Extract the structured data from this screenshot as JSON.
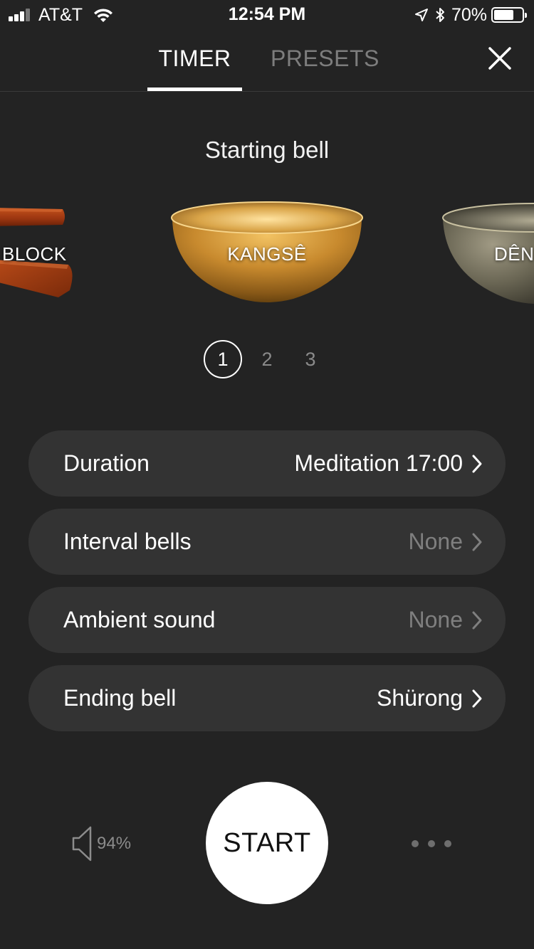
{
  "status_bar": {
    "carrier": "AT&T",
    "time": "12:54 PM",
    "battery_percent": "70%",
    "battery_level": 0.7
  },
  "header": {
    "tabs": [
      {
        "label": "TIMER",
        "active": true
      },
      {
        "label": "PRESETS",
        "active": false
      }
    ],
    "close_icon": "close-icon"
  },
  "starting_bell": {
    "title": "Starting bell",
    "bells": [
      {
        "label": "BLOCK"
      },
      {
        "label": "KANGSÊ",
        "selected": true
      },
      {
        "label": "DÊN"
      }
    ],
    "pages": [
      "1",
      "2",
      "3"
    ],
    "active_page": "1"
  },
  "settings": [
    {
      "label": "Duration",
      "value": "Meditation 17:00",
      "muted": false
    },
    {
      "label": "Interval bells",
      "value": "None",
      "muted": true
    },
    {
      "label": "Ambient sound",
      "value": "None",
      "muted": true
    },
    {
      "label": "Ending bell",
      "value": "Shürong",
      "muted": false
    }
  ],
  "controls": {
    "volume": "94%",
    "start_label": "START",
    "more_icon": "more-dots-icon"
  },
  "colors": {
    "background": "#232323",
    "row_background": "#333333",
    "muted_text": "#7f7f7f"
  }
}
